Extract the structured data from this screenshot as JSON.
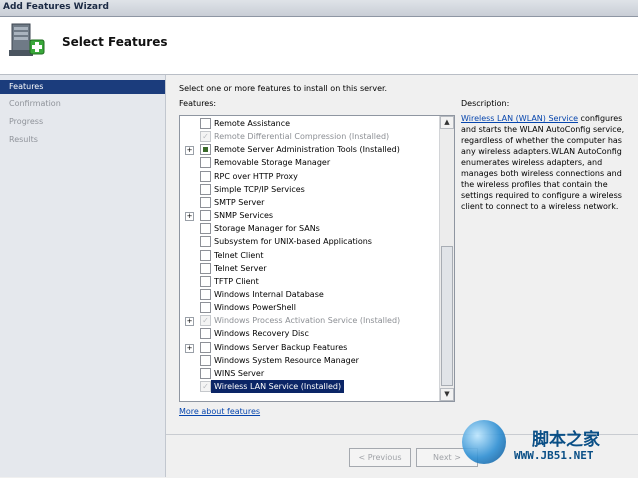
{
  "window": {
    "title": "Add Features Wizard"
  },
  "header": {
    "title": "Select Features",
    "icon": "server-features-icon"
  },
  "nav": {
    "items": [
      {
        "label": "Features",
        "active": true
      },
      {
        "label": "Confirmation",
        "active": false
      },
      {
        "label": "Progress",
        "active": false
      },
      {
        "label": "Results",
        "active": false
      }
    ]
  },
  "main": {
    "instructions": "Select one or more features to install on this server.",
    "features_label": "Features:",
    "features": [
      {
        "label": "Remote Assistance",
        "expandable": false,
        "state": "unchecked",
        "disabled": false
      },
      {
        "label": "Remote Differential Compression  (Installed)",
        "expandable": false,
        "state": "checked",
        "disabled": true
      },
      {
        "label": "Remote Server Administration Tools  (Installed)",
        "expandable": true,
        "state": "partial",
        "disabled": false
      },
      {
        "label": "Removable Storage Manager",
        "expandable": false,
        "state": "unchecked",
        "disabled": false
      },
      {
        "label": "RPC over HTTP Proxy",
        "expandable": false,
        "state": "unchecked",
        "disabled": false
      },
      {
        "label": "Simple TCP/IP Services",
        "expandable": false,
        "state": "unchecked",
        "disabled": false
      },
      {
        "label": "SMTP Server",
        "expandable": false,
        "state": "unchecked",
        "disabled": false
      },
      {
        "label": "SNMP Services",
        "expandable": true,
        "state": "unchecked",
        "disabled": false
      },
      {
        "label": "Storage Manager for SANs",
        "expandable": false,
        "state": "unchecked",
        "disabled": false
      },
      {
        "label": "Subsystem for UNIX-based Applications",
        "expandable": false,
        "state": "unchecked",
        "disabled": false
      },
      {
        "label": "Telnet Client",
        "expandable": false,
        "state": "unchecked",
        "disabled": false
      },
      {
        "label": "Telnet Server",
        "expandable": false,
        "state": "unchecked",
        "disabled": false
      },
      {
        "label": "TFTP Client",
        "expandable": false,
        "state": "unchecked",
        "disabled": false
      },
      {
        "label": "Windows Internal Database",
        "expandable": false,
        "state": "unchecked",
        "disabled": false
      },
      {
        "label": "Windows PowerShell",
        "expandable": false,
        "state": "unchecked",
        "disabled": false
      },
      {
        "label": "Windows Process Activation Service  (Installed)",
        "expandable": true,
        "state": "checked",
        "disabled": true
      },
      {
        "label": "Windows Recovery Disc",
        "expandable": false,
        "state": "unchecked",
        "disabled": false
      },
      {
        "label": "Windows Server Backup Features",
        "expandable": true,
        "state": "unchecked",
        "disabled": false
      },
      {
        "label": "Windows System Resource Manager",
        "expandable": false,
        "state": "unchecked",
        "disabled": false
      },
      {
        "label": "WINS Server",
        "expandable": false,
        "state": "unchecked",
        "disabled": false
      },
      {
        "label": "Wireless LAN Service  (Installed)",
        "expandable": false,
        "state": "checked",
        "disabled": true,
        "selected": true
      }
    ],
    "more_link": "More about features",
    "description": {
      "label": "Description:",
      "link": "Wireless LAN (WLAN) Service",
      "text": " configures and starts the WLAN AutoConfig service, regardless of whether the computer has any wireless adapters.WLAN AutoConfig enumerates wireless adapters, and manages both wireless connections and the wireless profiles that contain the settings required to configure a wireless client to connect to a wireless network."
    }
  },
  "footer": {
    "previous_label": "< Previous",
    "next_label": "Next >"
  },
  "watermark": {
    "text": "脚本之家",
    "url": "WWW.JB51.NET"
  }
}
